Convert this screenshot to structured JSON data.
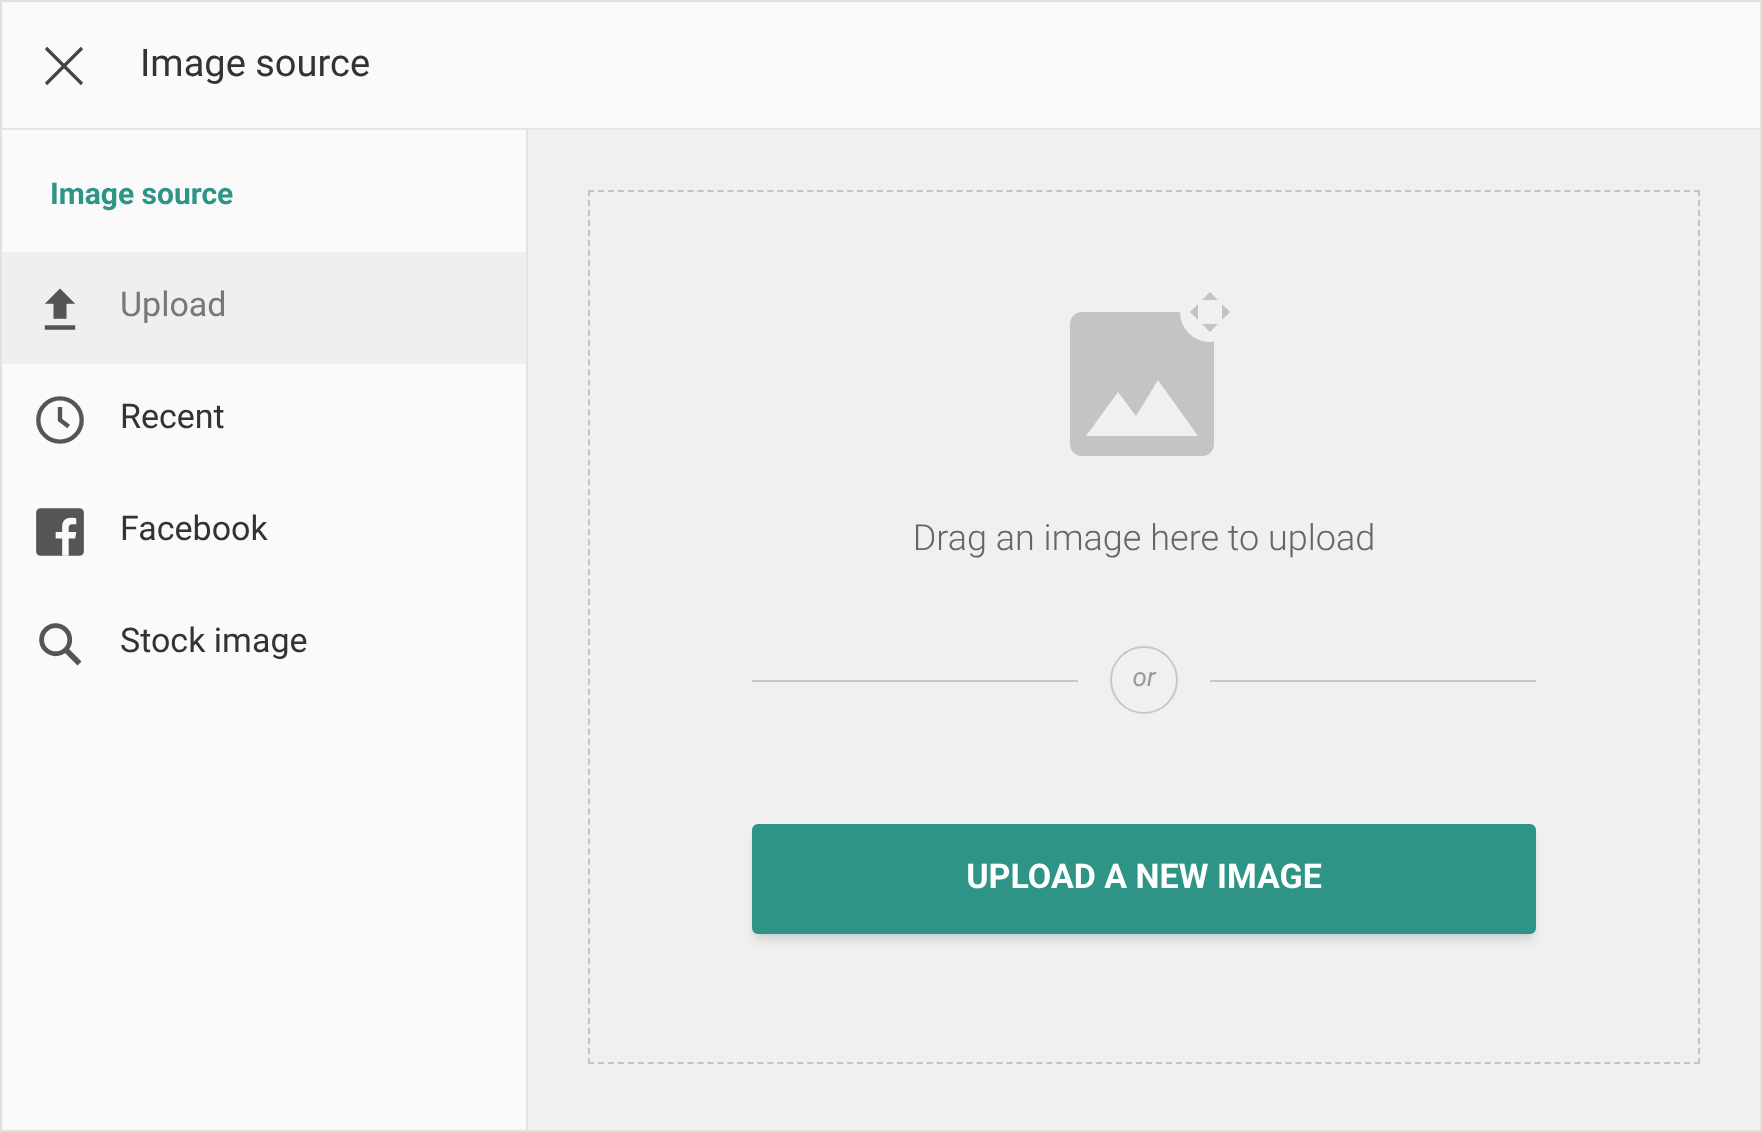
{
  "window": {
    "title": "Image source"
  },
  "sidebar": {
    "heading": "Image source",
    "items": [
      {
        "label": "Upload",
        "kind": "upload",
        "selected": true
      },
      {
        "label": "Recent",
        "kind": "recent",
        "selected": false
      },
      {
        "label": "Facebook",
        "kind": "facebook",
        "selected": false
      },
      {
        "label": "Stock image",
        "kind": "search",
        "selected": false
      }
    ]
  },
  "dropzone": {
    "hint": "Drag an image here to upload",
    "separator": "or",
    "button": "UPLOAD A NEW IMAGE"
  }
}
